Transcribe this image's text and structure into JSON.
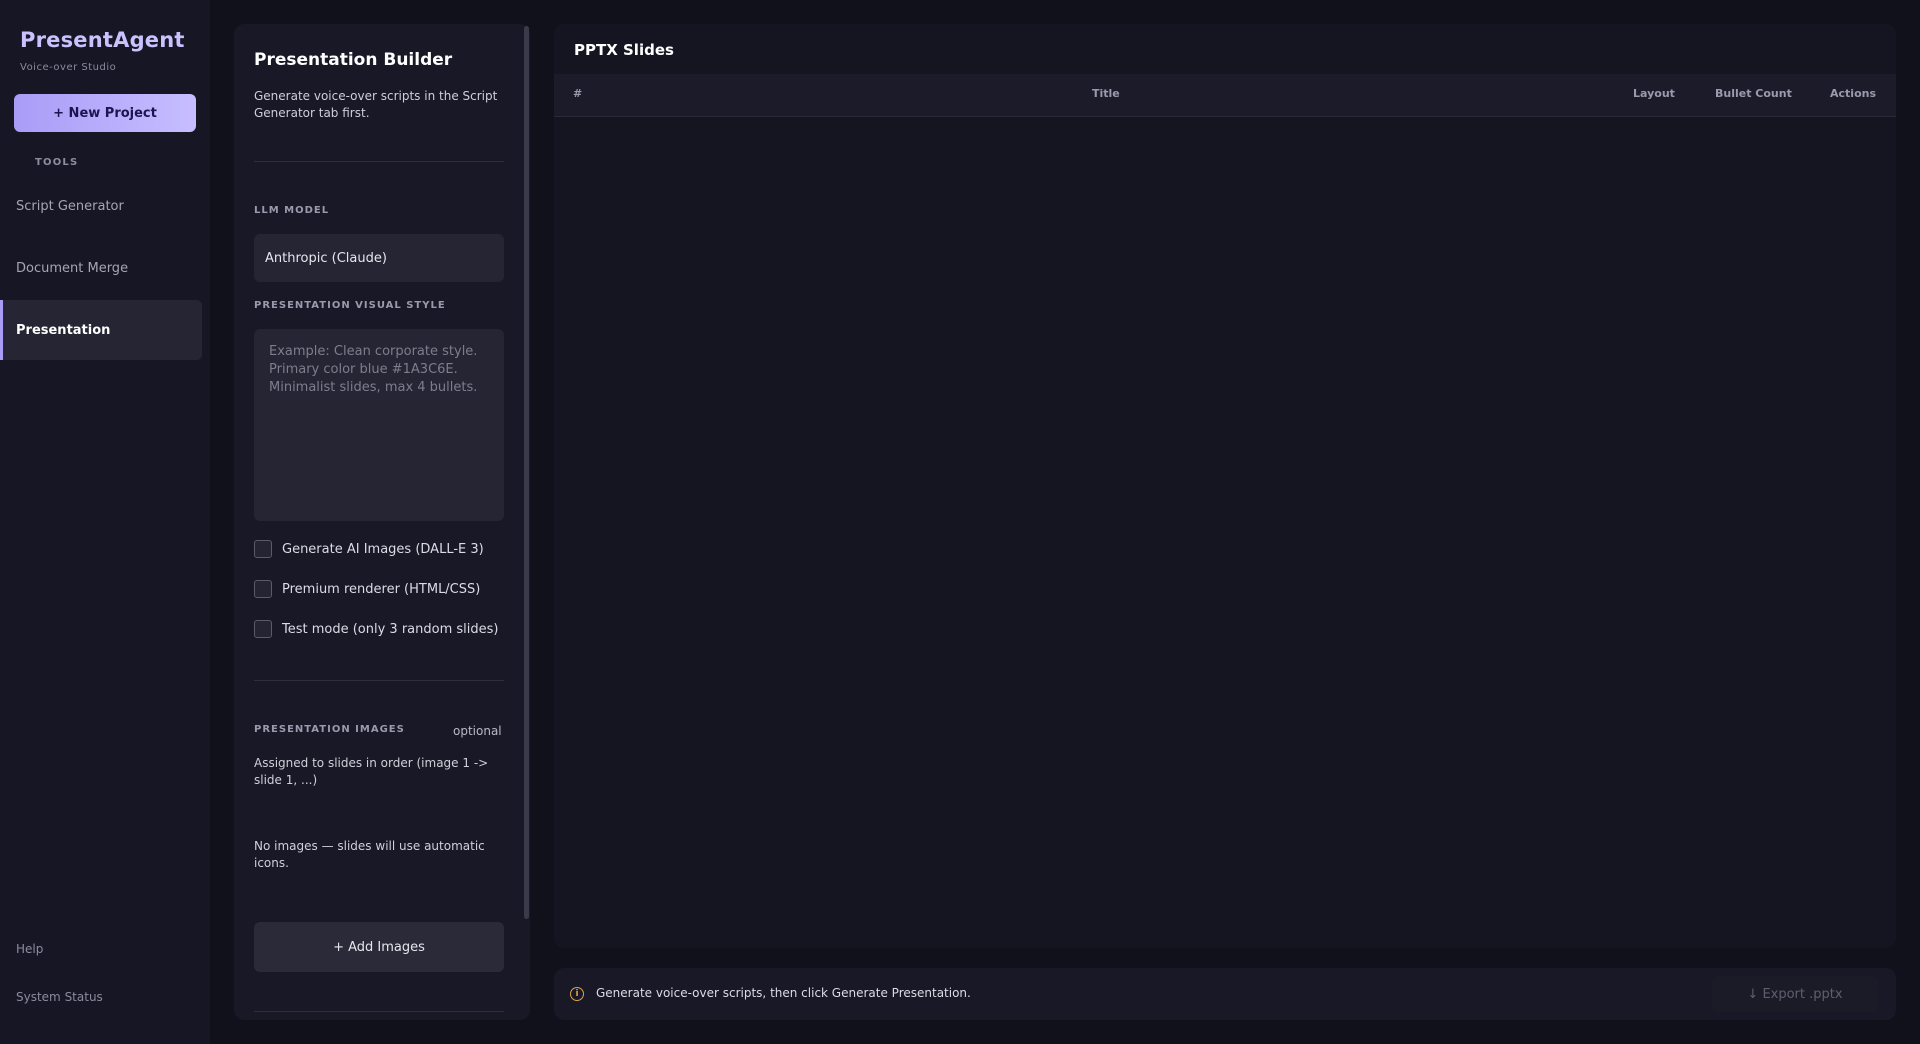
{
  "sidebar": {
    "brand": "PresentAgent",
    "subtitle": "Voice-over Studio",
    "new_project_label": "+ New Project",
    "tools_label": "TOOLS",
    "items": [
      {
        "label": "Script Generator",
        "active": false
      },
      {
        "label": "Document Merge",
        "active": false
      },
      {
        "label": "Presentation",
        "active": true
      }
    ],
    "footer": {
      "help": "Help",
      "system_status": "System Status"
    }
  },
  "builder": {
    "title": "Presentation Builder",
    "description": "Generate voice-over scripts in the Script Generator tab first.",
    "llm_model_label": "LLM MODEL",
    "llm_model_value": "Anthropic (Claude)",
    "visual_style_label": "PRESENTATION VISUAL STYLE",
    "visual_style_placeholder": "Example: Clean corporate style. Primary color blue #1A3C6E. Minimalist slides, max 4 bullets.",
    "options": [
      {
        "label": "Generate AI Images (DALL-E 3)",
        "checked": false
      },
      {
        "label": "Premium renderer (HTML/CSS)",
        "checked": false
      },
      {
        "label": "Test mode (only 3 random slides)",
        "checked": false
      }
    ],
    "images_label": "PRESENTATION IMAGES",
    "images_optional": "optional",
    "images_description": "Assigned to slides in order (image 1 -> slide 1, ...)",
    "images_empty": "No images — slides will use automatic icons.",
    "add_images_label": "+ Add Images"
  },
  "slides": {
    "title": "PPTX Slides",
    "columns": {
      "number": "#",
      "title": "Title",
      "layout": "Layout",
      "bullet_count": "Bullet Count",
      "actions": "Actions"
    },
    "rows": []
  },
  "status": {
    "message": "Generate voice-over scripts, then click Generate Presentation.",
    "export_label": "↓ Export .pptx"
  },
  "colors": {
    "accent": "#a99cf7",
    "background": "#11111c",
    "info": "#e0a24a"
  },
  "icons": {
    "status": "info-icon"
  }
}
